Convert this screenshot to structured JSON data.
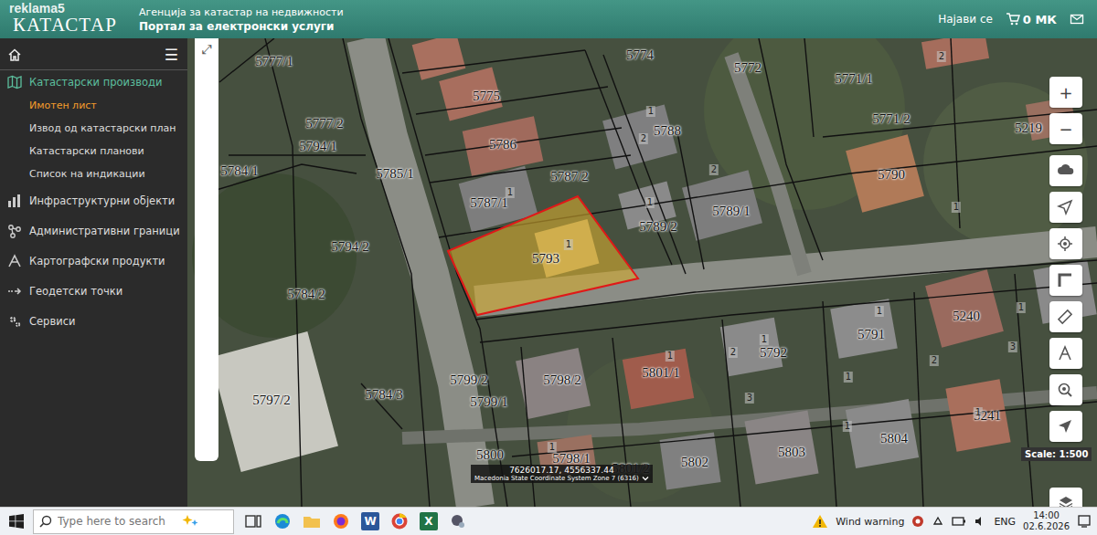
{
  "header": {
    "watermark": "reklama5",
    "logo": "КАТАСТАР",
    "agency": "Агенција за катастар на недвижности",
    "portal": "Портал за електронски услуги",
    "login": "Најави се",
    "cart": "0 МК"
  },
  "sidebar": {
    "menu": "☰",
    "items": [
      {
        "label": "Катастарски производи",
        "expanded": true,
        "children": [
          {
            "label": "Имотен лист",
            "selected": true
          },
          {
            "label": "Извод од катастарски план",
            "selected": false
          },
          {
            "label": "Катастарски планови",
            "selected": false
          },
          {
            "label": "Список на индикации",
            "selected": false
          }
        ]
      },
      {
        "label": "Инфраструктурни објекти",
        "expanded": false,
        "children": []
      },
      {
        "label": "Административни граници",
        "expanded": false,
        "children": []
      },
      {
        "label": "Картографски продукти",
        "expanded": false,
        "children": []
      },
      {
        "label": "Геодетски точки",
        "expanded": false,
        "children": []
      },
      {
        "label": "Сервиси",
        "expanded": false,
        "children": []
      }
    ]
  },
  "map": {
    "expand": "⤢",
    "zoom_in": "+",
    "zoom_out": "−",
    "scale": "Scale: 1:500",
    "coords": "7626017.17, 4556337.44",
    "crs": "Macedonia State Coordinate System Zone 7 (6316)",
    "parcels": [
      {
        "label": "5777/1",
        "selected": false
      },
      {
        "label": "5777/2",
        "selected": false
      },
      {
        "label": "5794/1",
        "selected": false
      },
      {
        "label": "5784/1",
        "selected": false
      },
      {
        "label": "5785/1",
        "selected": false
      },
      {
        "label": "5794/2",
        "selected": false
      },
      {
        "label": "5784/2",
        "selected": false
      },
      {
        "label": "5797/2",
        "selected": false
      },
      {
        "label": "5784/3",
        "selected": false
      },
      {
        "label": "5775",
        "selected": false
      },
      {
        "label": "5786",
        "selected": false
      },
      {
        "label": "5787/1",
        "selected": false
      },
      {
        "label": "5787/2",
        "selected": false
      },
      {
        "label": "5793",
        "selected": true
      },
      {
        "label": "5774",
        "selected": false
      },
      {
        "label": "5772",
        "selected": false
      },
      {
        "label": "5788",
        "selected": false
      },
      {
        "label": "5789/2",
        "selected": false
      },
      {
        "label": "5789/1",
        "selected": false
      },
      {
        "label": "5771/1",
        "selected": false
      },
      {
        "label": "5771/2",
        "selected": false
      },
      {
        "label": "5790",
        "selected": false
      },
      {
        "label": "5219",
        "selected": false
      },
      {
        "label": "5799/2",
        "selected": false
      },
      {
        "label": "5799/1",
        "selected": false
      },
      {
        "label": "5798/2",
        "selected": false
      },
      {
        "label": "5801/1",
        "selected": false
      },
      {
        "label": "5792",
        "selected": false
      },
      {
        "label": "5791",
        "selected": false
      },
      {
        "label": "5240",
        "selected": false
      },
      {
        "label": "5241",
        "selected": false
      },
      {
        "label": "5804",
        "selected": false
      },
      {
        "label": "5803",
        "selected": false
      },
      {
        "label": "5802",
        "selected": false
      },
      {
        "label": "5801/2",
        "selected": false
      },
      {
        "label": "5800",
        "selected": false
      },
      {
        "label": "5798/1",
        "selected": false
      }
    ],
    "building_numbers": [
      "1",
      "1",
      "1",
      "2",
      "1",
      "2",
      "1",
      "2",
      "1",
      "1",
      "2",
      "3",
      "1",
      "1",
      "1",
      "2",
      "3",
      "1",
      "1",
      "1"
    ]
  },
  "taskbar": {
    "search": {
      "placeholder": "Type here to search"
    },
    "apps": [
      {
        "label": "W"
      },
      {
        "label": "X"
      }
    ],
    "weather": "Wind warning",
    "lang": "ENG",
    "time": "14:00",
    "date": "02.6.2026"
  }
}
